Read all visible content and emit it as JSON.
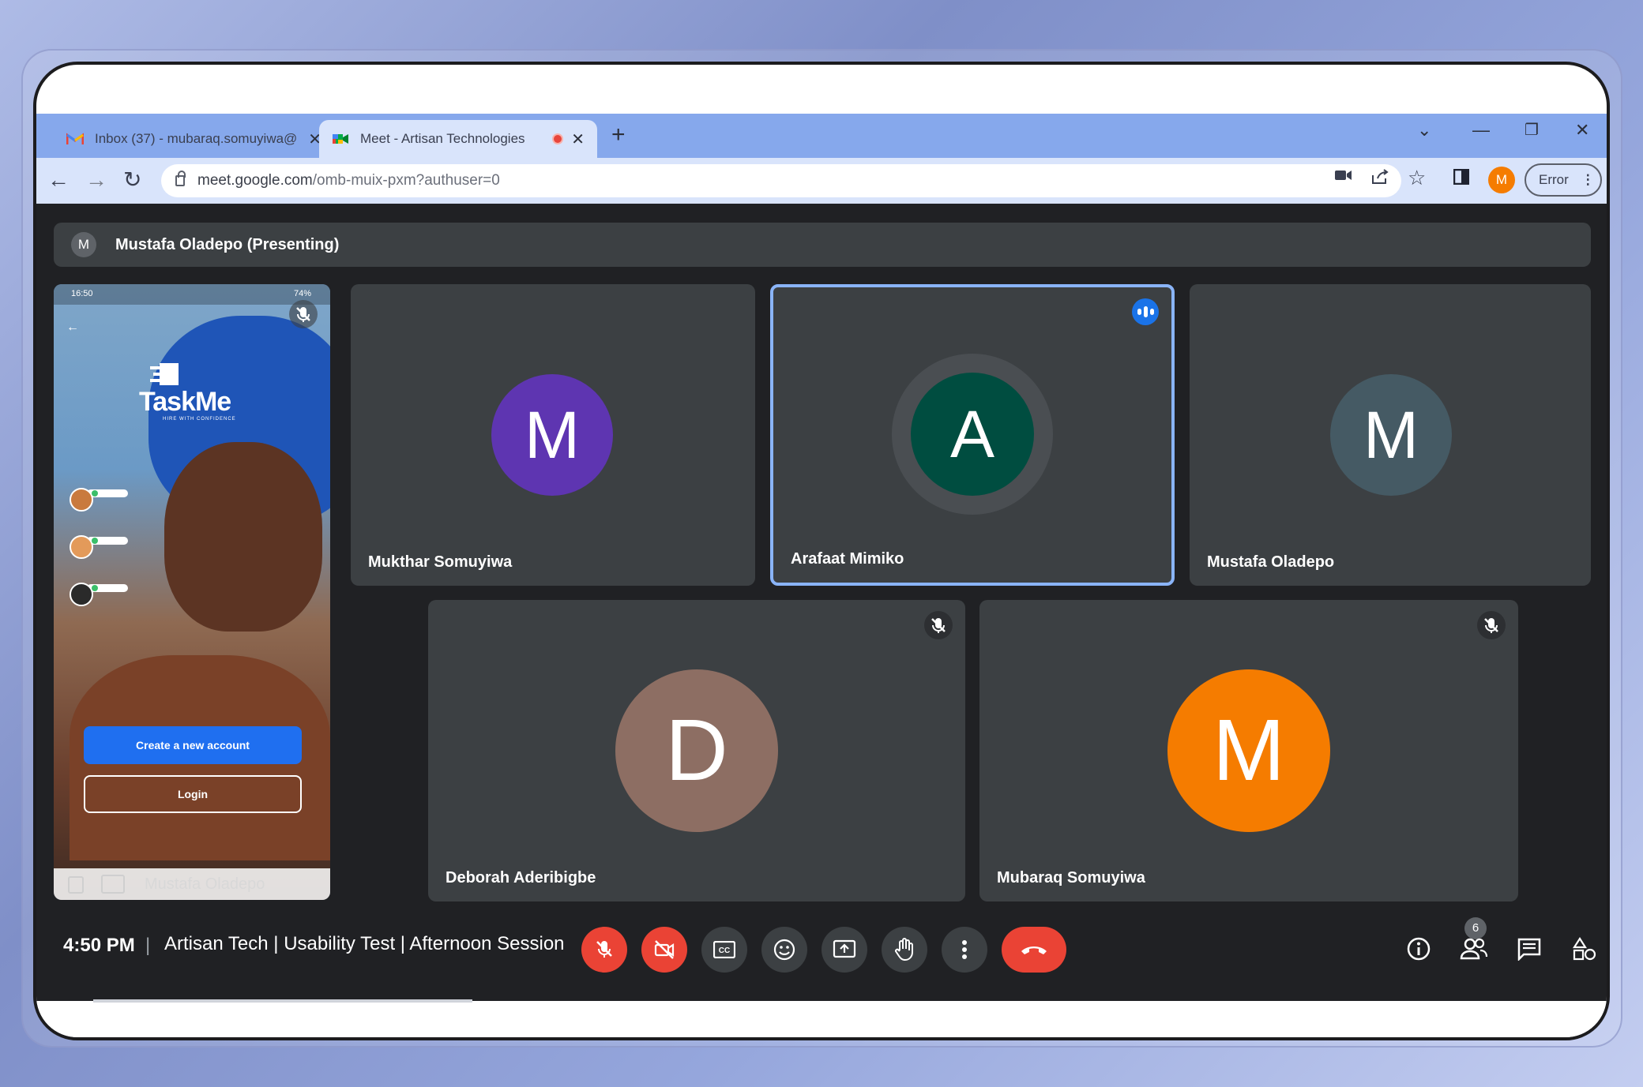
{
  "browser": {
    "tabs": [
      {
        "title": "Inbox (37) - mubaraq.somuyiwa@",
        "icon": "gmail-icon",
        "active": false
      },
      {
        "title": "Meet - Artisan Technologies",
        "icon": "meet-icon",
        "active": true,
        "recording": true
      }
    ],
    "new_tab": "+",
    "url_host": "meet.google.com",
    "url_path": "/omb-muix-pxm?authuser=0",
    "profile_initial": "M",
    "profile_color": "#f57c00",
    "error_label": "Error"
  },
  "meet": {
    "presenter_initial": "M",
    "presenter_banner": "Mustafa Oladepo (Presenting)",
    "shared_screen": {
      "status_time": "16:50",
      "status_battery": "74%",
      "app_name": "TaskMe",
      "app_tagline": "HIRE WITH CONFIDENCE",
      "create_button": "Create a new account",
      "login_button": "Login",
      "footer_name": "Mustafa Oladepo"
    },
    "participants": [
      {
        "name": "Mukthar Somuyiwa",
        "initial": "M",
        "color": "#5e35b1",
        "muted": false,
        "speaking": false
      },
      {
        "name": "Arafaat Mimiko",
        "initial": "A",
        "color": "#004d40",
        "muted": false,
        "speaking": true
      },
      {
        "name": "Mustafa Oladepo",
        "initial": "M",
        "color": "#455a64",
        "muted": false,
        "speaking": false
      },
      {
        "name": "Deborah Aderibigbe",
        "initial": "D",
        "color": "#8d6e63",
        "muted": true,
        "speaking": false
      },
      {
        "name": "Mubaraq Somuyiwa",
        "initial": "M",
        "color": "#f57c00",
        "muted": true,
        "speaking": false
      }
    ],
    "bottom_bar": {
      "time": "4:50 PM",
      "separator": "|",
      "meeting_title": "Artisan Tech | Usability Test | Afternoon Session",
      "participant_count": "6"
    }
  }
}
